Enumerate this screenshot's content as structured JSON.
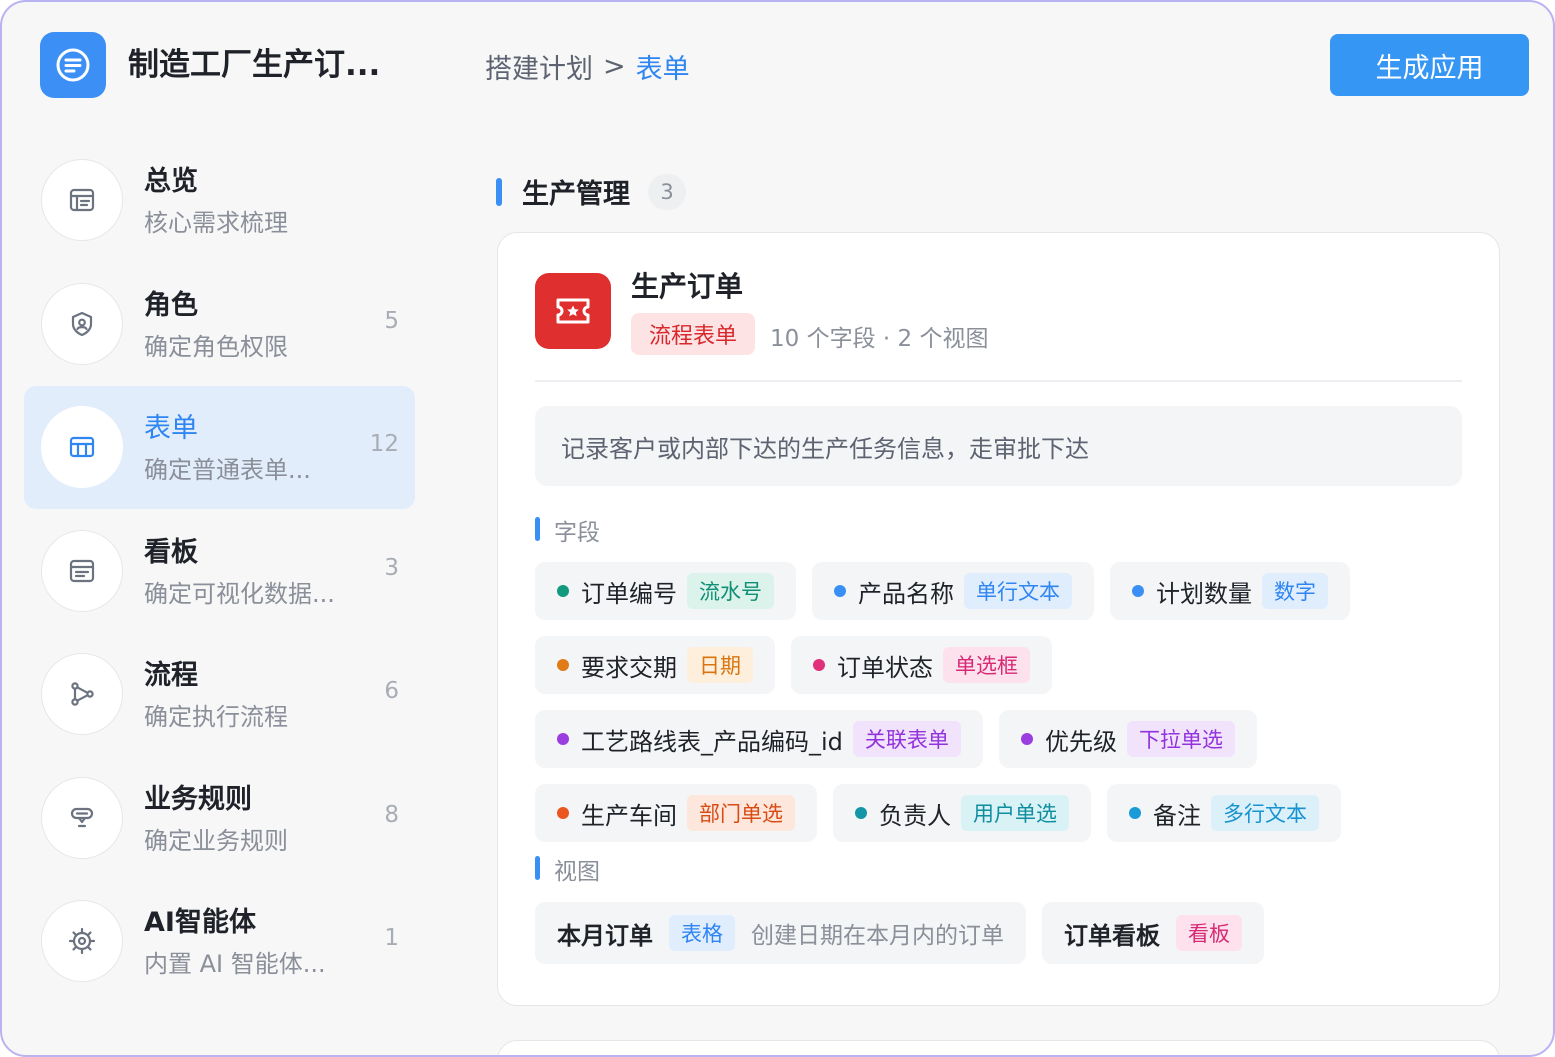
{
  "header": {
    "app_title": "制造工厂生产订...",
    "breadcrumb": [
      "搭建计划",
      ">",
      "表单"
    ],
    "generate_label": "生成应用"
  },
  "sidebar": {
    "items": [
      {
        "title": "总览",
        "subtitle": "核心需求梳理",
        "count": "",
        "icon": "overview-icon"
      },
      {
        "title": "角色",
        "subtitle": "确定角色权限",
        "count": "5",
        "icon": "role-shield-icon"
      },
      {
        "title": "表单",
        "subtitle": "确定普通表单...",
        "count": "12",
        "icon": "form-table-icon",
        "active": true
      },
      {
        "title": "看板",
        "subtitle": "确定可视化数据...",
        "count": "3",
        "icon": "dashboard-icon"
      },
      {
        "title": "流程",
        "subtitle": "确定执行流程",
        "count": "6",
        "icon": "workflow-icon"
      },
      {
        "title": "业务规则",
        "subtitle": "确定业务规则",
        "count": "8",
        "icon": "business-rule-icon"
      },
      {
        "title": "AI智能体",
        "subtitle": "内置 AI 智能体...",
        "count": "1",
        "icon": "ai-agent-icon"
      }
    ]
  },
  "section": {
    "title": "生产管理",
    "count": "3"
  },
  "form": {
    "name": "生产订单",
    "type_label": "流程表单",
    "meta": "10 个字段 · 2 个视图",
    "description": "记录客户或内部下达的生产任务信息，走审批下达",
    "fields_title": "字段",
    "views_title": "视图",
    "fields": [
      {
        "name": "订单编号",
        "type": "流水号",
        "dot": "#129a7e",
        "fg": "#0f8f74",
        "bg": "#dcf3ec"
      },
      {
        "name": "产品名称",
        "type": "单行文本",
        "dot": "#3a8ff5",
        "fg": "#2f86f2",
        "bg": "#e0edfd"
      },
      {
        "name": "计划数量",
        "type": "数字",
        "dot": "#3a8ff5",
        "fg": "#2f86f2",
        "bg": "#e0edfd"
      },
      {
        "name": "要求交期",
        "type": "日期",
        "dot": "#e07b16",
        "fg": "#d9740f",
        "bg": "#fdefdc"
      },
      {
        "name": "订单状态",
        "type": "单选框",
        "dot": "#e0307a",
        "fg": "#d62b74",
        "bg": "#fde2ee"
      },
      {
        "name": "工艺路线表_产品编码_id",
        "type": "关联表单",
        "dot": "#9a3ee0",
        "fg": "#9232dc",
        "bg": "#f1e3fc"
      },
      {
        "name": "优先级",
        "type": "下拉单选",
        "dot": "#9a3ee0",
        "fg": "#9232dc",
        "bg": "#f1e3fc"
      },
      {
        "name": "生产车间",
        "type": "部门单选",
        "dot": "#ea5520",
        "fg": "#d94b14",
        "bg": "#fde7dc"
      },
      {
        "name": "负责人",
        "type": "用户单选",
        "dot": "#1296a8",
        "fg": "#0f8ea0",
        "bg": "#d9f2f5"
      },
      {
        "name": "备注",
        "type": "多行文本",
        "dot": "#1a9ad6",
        "fg": "#1693d0",
        "bg": "#dcf0fa"
      }
    ],
    "views": [
      {
        "name": "本月订单",
        "type": "表格",
        "desc": "创建日期在本月内的订单",
        "fg": "#2f86f2",
        "bg": "#e0edfd"
      },
      {
        "name": "订单看板",
        "type": "看板",
        "desc": "",
        "fg": "#d62b74",
        "bg": "#fde2ee"
      }
    ]
  },
  "colors": {
    "accent": "#3596f4",
    "active_bg": "#e2edfb",
    "form_icon_bg": "#e02f2f"
  }
}
